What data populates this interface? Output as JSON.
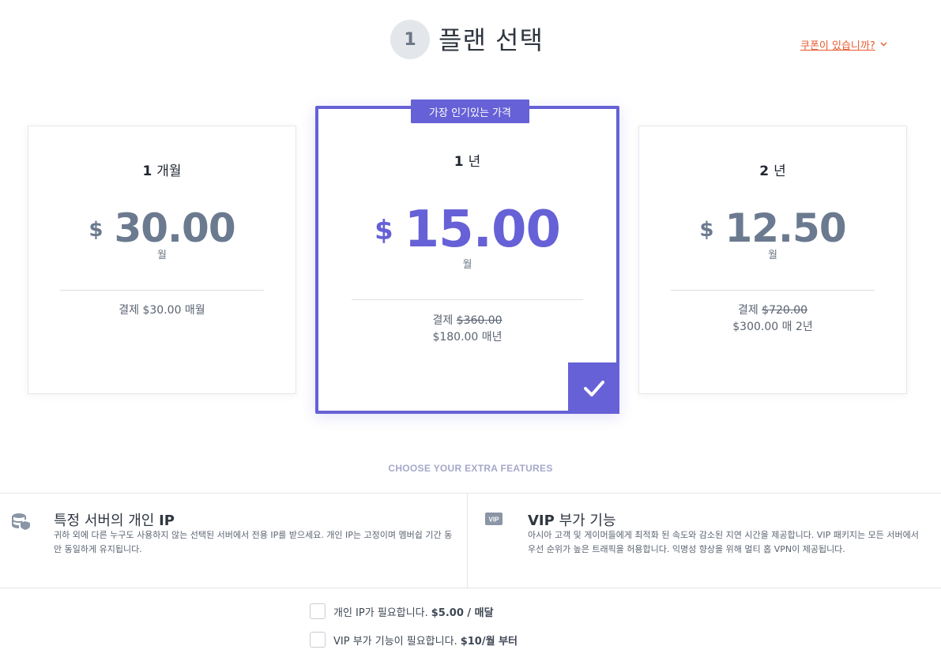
{
  "header": {
    "step_number": "1",
    "title": "플랜 선택",
    "coupon_link": "쿠폰이 있습니까?"
  },
  "plans": [
    {
      "period_num": "1",
      "period_unit": "개월",
      "currency": "$",
      "price": "30.00",
      "per": "월",
      "billing_line1": "결제 $30.00 매월",
      "billing_prefix": "",
      "billing_strike": "",
      "billing_line2": ""
    },
    {
      "badge": "가장 인기있는 가격",
      "period_num": "1",
      "period_unit": "년",
      "currency": "$",
      "price": "15.00",
      "per": "월",
      "billing_prefix": "결제",
      "billing_strike": "$360.00",
      "billing_line2": "$180.00 매년",
      "selected": true
    },
    {
      "period_num": "2",
      "period_unit": "년",
      "currency": "$",
      "price": "12.50",
      "per": "월",
      "billing_prefix": "결제",
      "billing_strike": "$720.00",
      "billing_line2": "$300.00 매 2년"
    }
  ],
  "extras": {
    "title": "CHOOSE YOUR EXTRA FEATURES",
    "features": [
      {
        "icon": "database-shield-icon",
        "title_prefix": "특정 서버의 개인",
        "title_bold": "IP",
        "desc": "귀하 외에 다른 누구도 사용하지 않는 선택된 서버에서 전용 IP를 받으세요. 개인 IP는 고정이며 멤버쉽 기간 동안 동일하게 유지됩니다."
      },
      {
        "icon": "vip-icon",
        "icon_text": "VIP",
        "title_bold": "VIP",
        "title_suffix": "부가 기능",
        "desc": "아시아 고객 및 게이머들에게 최적화 된 속도와 감소된 지연 시간을 제공합니다. VIP 패키지는 모든 서버에서 우선 순위가 높은 트래픽을 허용합니다. 익명성 향상을 위해 멀티 홉 VPN이 제공됩니다."
      }
    ],
    "options": [
      {
        "label": "개인 IP가 필요합니다.",
        "price": "$5.00 / 매달",
        "checked": false
      },
      {
        "label": "VIP 부가 기능이 필요합니다.",
        "price": "$10/월 부터",
        "checked": false
      }
    ]
  },
  "colors": {
    "accent": "#6661d6",
    "coupon": "#e9592f",
    "price_gray": "#6b7a8f"
  }
}
